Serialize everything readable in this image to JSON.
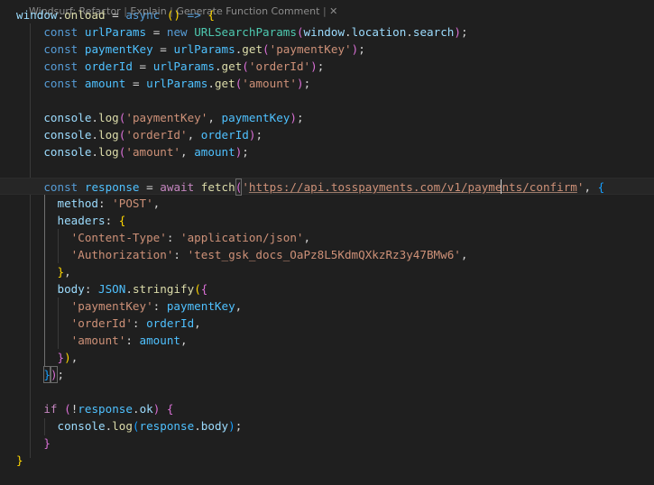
{
  "codelens": {
    "refactor": "Windsurf: Refactor",
    "explain": "Explain",
    "generate_comment": "Generate Function Comment",
    "close": "✕"
  },
  "code": {
    "l1_target": "window",
    "l1_member": "onload",
    "l1_async": "async",
    "l2_name": "urlParams",
    "l2_class": "URLSearchParams",
    "l2_window": "window",
    "l2_location": "location",
    "l2_search": "search",
    "l3_name": "paymentKey",
    "l3_obj": "urlParams",
    "l3_method": "get",
    "l3_arg": "'paymentKey'",
    "l4_name": "orderId",
    "l4_obj": "urlParams",
    "l4_method": "get",
    "l4_arg": "'orderId'",
    "l5_name": "amount",
    "l5_obj": "urlParams",
    "l5_method": "get",
    "l5_arg": "'amount'",
    "l7_obj": "console",
    "l7_method": "log",
    "l7_str": "'paymentKey'",
    "l7_var": "paymentKey",
    "l8_obj": "console",
    "l8_method": "log",
    "l8_str": "'orderId'",
    "l8_var": "orderId",
    "l9_obj": "console",
    "l9_method": "log",
    "l9_str": "'amount'",
    "l9_var": "amount",
    "l11_name": "response",
    "l11_fn": "fetch",
    "l11_url_part1": "https://api.tosspayments.com/v1/payme",
    "l11_url_part2": "nts/confirm",
    "l12_key": "method",
    "l12_val": "'POST'",
    "l13_key": "headers",
    "l14_key": "'Content-Type'",
    "l14_val": "'application/json'",
    "l15_key": "'Authorization'",
    "l15_val": "'test_gsk_docs_OaPz8L5KdmQXkzRz3y47BMw6'",
    "l17_key": "body",
    "l17_obj": "JSON",
    "l17_method": "stringify",
    "l18_key": "'paymentKey'",
    "l18_val": "paymentKey",
    "l19_key": "'orderId'",
    "l19_val": "orderId",
    "l20_key": "'amount'",
    "l20_val": "amount",
    "l24_obj": "response",
    "l24_prop": "ok",
    "l25_obj": "console",
    "l25_method": "log",
    "l25_arg_obj": "response",
    "l25_arg_prop": "body"
  }
}
